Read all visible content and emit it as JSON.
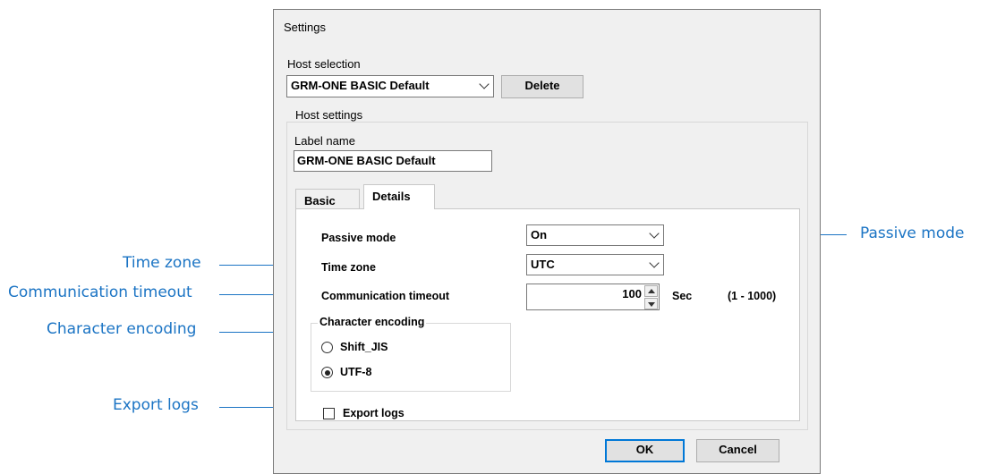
{
  "callouts": {
    "time_zone": "Time zone",
    "communication_timeout": "Communication timeout",
    "character_encoding": "Character encoding",
    "export_logs": "Export logs",
    "passive_mode": "Passive mode"
  },
  "dialog": {
    "title": "Settings",
    "host_selection": {
      "label": "Host selection",
      "selected": "GRM-ONE BASIC Default",
      "delete_label": "Delete"
    },
    "host_settings": {
      "group_label": "Host settings",
      "label_name_label": "Label name",
      "label_name_value": "GRM-ONE BASIC Default",
      "tabs": [
        {
          "label": "Basic",
          "active": false
        },
        {
          "label": "Details",
          "active": true
        }
      ],
      "details": {
        "passive_mode_label": "Passive mode",
        "passive_mode_value": "On",
        "time_zone_label": "Time zone",
        "time_zone_value": "UTC",
        "comm_timeout_label": "Communication timeout",
        "comm_timeout_value": "100",
        "comm_timeout_unit": "Sec",
        "comm_timeout_range": "(1 - 1000)",
        "encoding": {
          "group_label": "Character encoding",
          "options": [
            {
              "label": "Shift_JIS",
              "selected": false
            },
            {
              "label": "UTF-8",
              "selected": true
            }
          ]
        },
        "export_logs_label": "Export logs",
        "export_logs_checked": false
      }
    },
    "ok_label": "OK",
    "cancel_label": "Cancel"
  },
  "colors": {
    "callout": "#1b74c4",
    "dialog_bg": "#f0f0f0",
    "default_button_border": "#0078d7"
  }
}
